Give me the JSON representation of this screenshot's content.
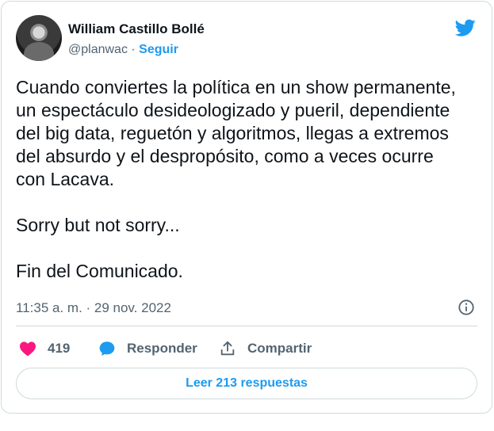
{
  "author": {
    "name": "William Castillo Bollé",
    "handle": "@planwac",
    "separator": " · ",
    "follow_label": "Seguir"
  },
  "tweet": {
    "paragraphs": [
      "Cuando conviertes la política en un show permanente, un espectáculo desideologizado y pueril, dependiente del big data, reguetón y algoritmos, llegas a extremos del absurdo y el despropósito, como a veces ocurre con Lacava.",
      "Sorry but not sorry...",
      "Fin del Comunicado."
    ],
    "timestamp": "11:35 a. m. · 29 nov. 2022"
  },
  "actions": {
    "like_count": "419",
    "reply_label": "Responder",
    "share_label": "Compartir"
  },
  "read_replies_label": "Leer 213 respuestas",
  "colors": {
    "brand": "#1d9bf0",
    "like": "#f91880",
    "muted": "#536471",
    "text": "#0f1419",
    "border": "#cfd9de"
  },
  "icons": [
    "twitter-bird-icon",
    "info-icon",
    "heart-icon",
    "reply-bubble-icon",
    "share-icon"
  ]
}
